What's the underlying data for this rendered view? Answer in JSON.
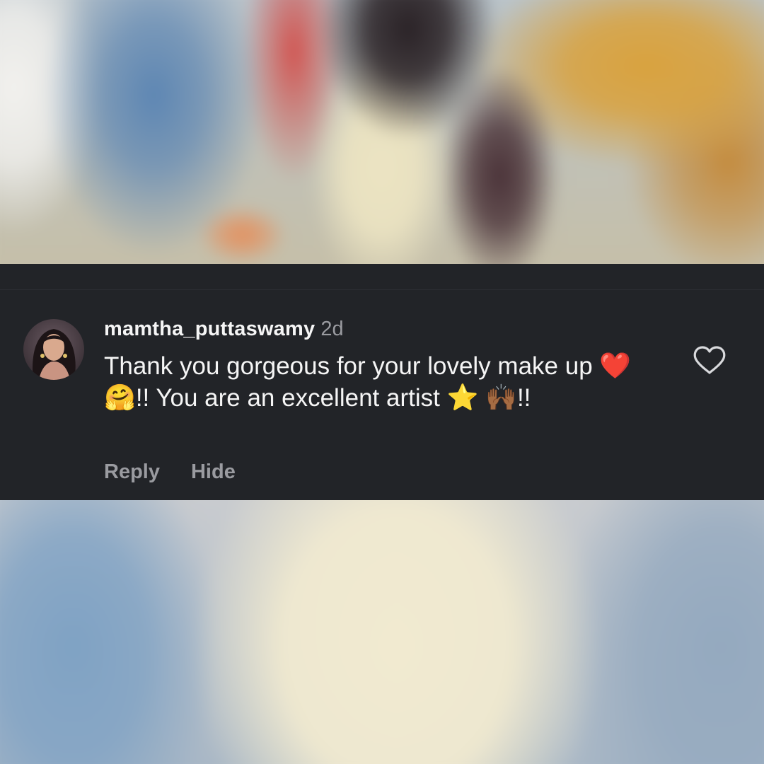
{
  "comment": {
    "username": "mamtha_puttaswamy",
    "timestamp": "2d",
    "text_parts": {
      "line1": "Thank you gorgeous for your lovely make",
      "line2_start": "up ",
      "emoji_heart": "❤️",
      "emoji_hug": "🤗",
      "line2_end": "!! You are an excellent artist ",
      "emoji_star": "⭐",
      "emoji_raised_hands": "🙌🏾",
      "line3_end": "!!"
    },
    "like_icon": "heart-outline-icon"
  },
  "actions": {
    "reply_label": "Reply",
    "hide_label": "Hide"
  },
  "colors": {
    "panel_background": "#222428",
    "primary_text": "#f5f5f5",
    "secondary_text": "#9a9ba0"
  }
}
